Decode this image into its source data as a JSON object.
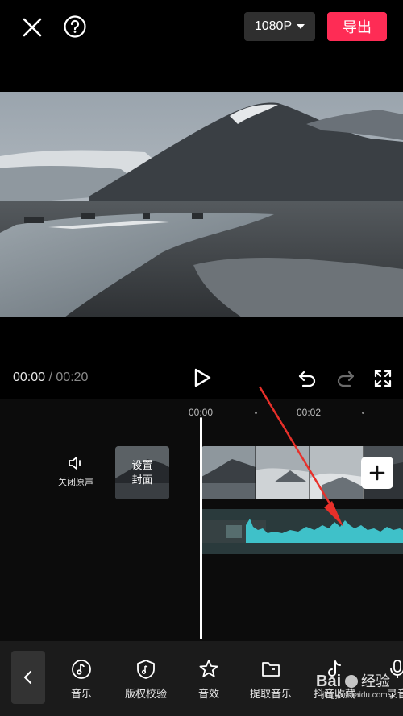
{
  "topbar": {
    "resolution": "1080P",
    "export_label": "导出"
  },
  "playback": {
    "current_time": "00:00",
    "separator": "/",
    "duration": "00:20"
  },
  "timeline": {
    "ruler": [
      "00:00",
      "00:02"
    ],
    "mute_label": "关闭原声",
    "cover_line1": "设置",
    "cover_line2": "封面"
  },
  "toolbar": {
    "items": [
      {
        "label": "音乐",
        "icon": "music-note-icon"
      },
      {
        "label": "版权校验",
        "icon": "shield-music-icon"
      },
      {
        "label": "音效",
        "icon": "star-sound-icon"
      },
      {
        "label": "提取音乐",
        "icon": "folder-icon"
      },
      {
        "label": "抖音收藏",
        "icon": "tiktok-icon"
      },
      {
        "label": "录音",
        "icon": "microphone-icon"
      }
    ]
  },
  "watermark": {
    "logo": "Bai 经验",
    "url": "jingyan.baidu.com"
  },
  "colors": {
    "export": "#fe2c55",
    "waveform": "#3fc1c9",
    "annotation_arrow": "#e8302a"
  }
}
